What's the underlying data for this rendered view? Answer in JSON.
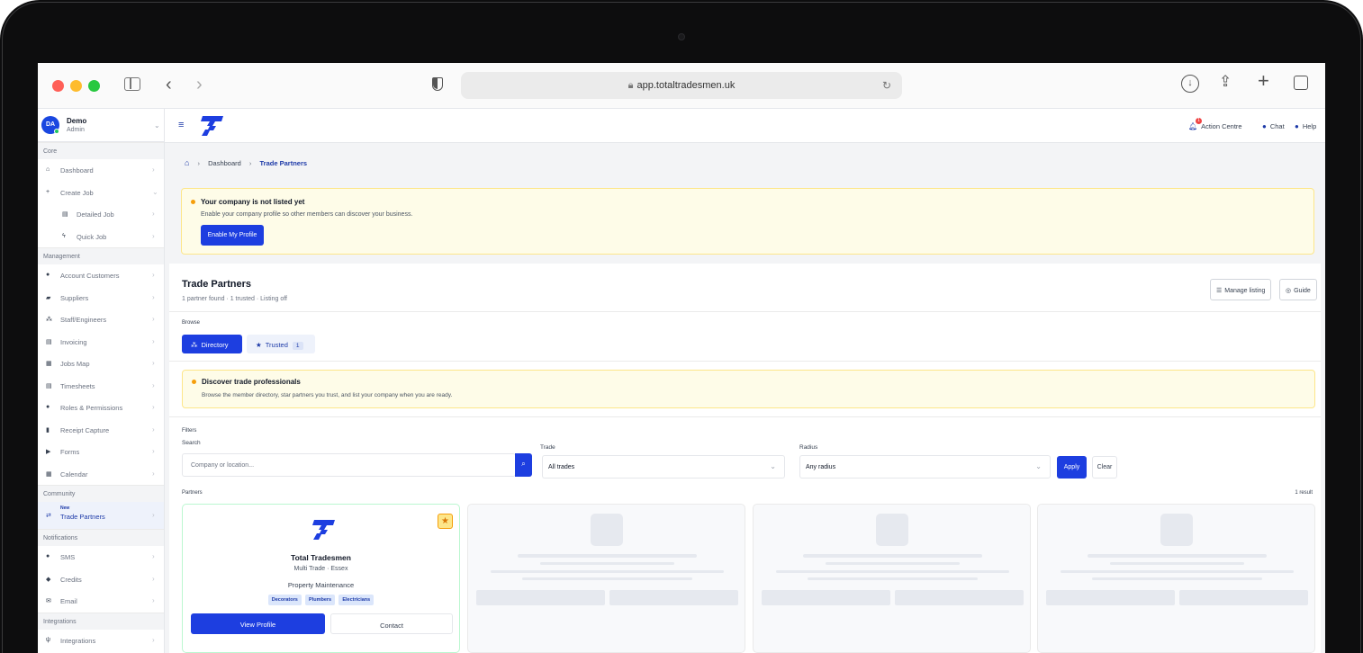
{
  "browser": {
    "url": "app.totaltradesmen.uk"
  },
  "user": {
    "initials": "DA",
    "name": "Demo",
    "role": "Admin"
  },
  "sidebar": {
    "sections": {
      "core": "Core",
      "management": "Management",
      "community": "Community",
      "notifications": "Notifications",
      "integrations": "Integrations"
    },
    "core_items": [
      {
        "label": "Dashboard",
        "icon": "dashboard-icon"
      },
      {
        "label": "Create Job",
        "icon": "plus-icon"
      },
      {
        "label": "Detailed Job",
        "icon": "document-icon"
      },
      {
        "label": "Quick Job",
        "icon": "bolt-icon"
      }
    ],
    "management_items": [
      {
        "label": "Account Customers",
        "icon": "user-icon"
      },
      {
        "label": "Suppliers",
        "icon": "truck-icon"
      },
      {
        "label": "Staff/Engineers",
        "icon": "team-icon"
      },
      {
        "label": "Invoicing",
        "icon": "invoice-icon"
      },
      {
        "label": "Jobs Map",
        "icon": "map-icon"
      },
      {
        "label": "Timesheets",
        "icon": "timesheet-icon"
      },
      {
        "label": "Roles & Permissions",
        "icon": "roles-icon"
      },
      {
        "label": "Receipt Capture",
        "icon": "receipt-icon"
      },
      {
        "label": "Forms",
        "icon": "forms-icon"
      },
      {
        "label": "Calendar",
        "icon": "calendar-icon"
      }
    ],
    "community_item": {
      "tag": "New",
      "label": "Trade Partners",
      "icon": "handshake-icon"
    },
    "notification_items": [
      {
        "label": "SMS",
        "icon": "sms-icon"
      },
      {
        "label": "Credits",
        "icon": "credits-icon"
      },
      {
        "label": "Email",
        "icon": "email-icon"
      }
    ],
    "integration_items": [
      {
        "label": "Integrations",
        "icon": "plug-icon"
      }
    ]
  },
  "topbar": {
    "action_centre": "Action Centre",
    "action_centre_badge": "1",
    "chat": "Chat",
    "help": "Help"
  },
  "breadcrumb": {
    "dashboard": "Dashboard",
    "current": "Trade Partners"
  },
  "listing_alert": {
    "title": "Your company is not listed yet",
    "text": "Enable your company profile so other members can discover your business.",
    "button": "Enable My Profile"
  },
  "page": {
    "title": "Trade Partners",
    "subtitle": "1 partner found · 1 trusted · Listing off",
    "manage_listing": "Manage listing",
    "guide": "Guide",
    "browse_label": "Browse",
    "tab_directory": "Directory",
    "tab_trusted": "Trusted",
    "trusted_count": "1"
  },
  "discover": {
    "title": "Discover trade professionals",
    "text": "Browse the member directory, star partners you trust, and list your company when you are ready."
  },
  "filters": {
    "heading": "Filters",
    "search_label": "Search",
    "search_placeholder": "Company or location...",
    "trade_label": "Trade",
    "trade_value": "All trades",
    "radius_label": "Radius",
    "radius_value": "Any radius",
    "apply": "Apply",
    "clear": "Clear"
  },
  "results": {
    "heading": "Partners",
    "count": "1 result"
  },
  "partner": {
    "name": "Total Tradesmen",
    "meta": "Multi Trade · Essex",
    "description": "Property Maintenance",
    "tags": [
      "Decorators",
      "Plumbers",
      "Electricians"
    ],
    "view_profile": "View Profile",
    "contact": "Contact",
    "starred": true
  },
  "colors": {
    "brand": "#1d3ee0",
    "alert_bg": "#fefce8",
    "star": "#f59e0b"
  }
}
